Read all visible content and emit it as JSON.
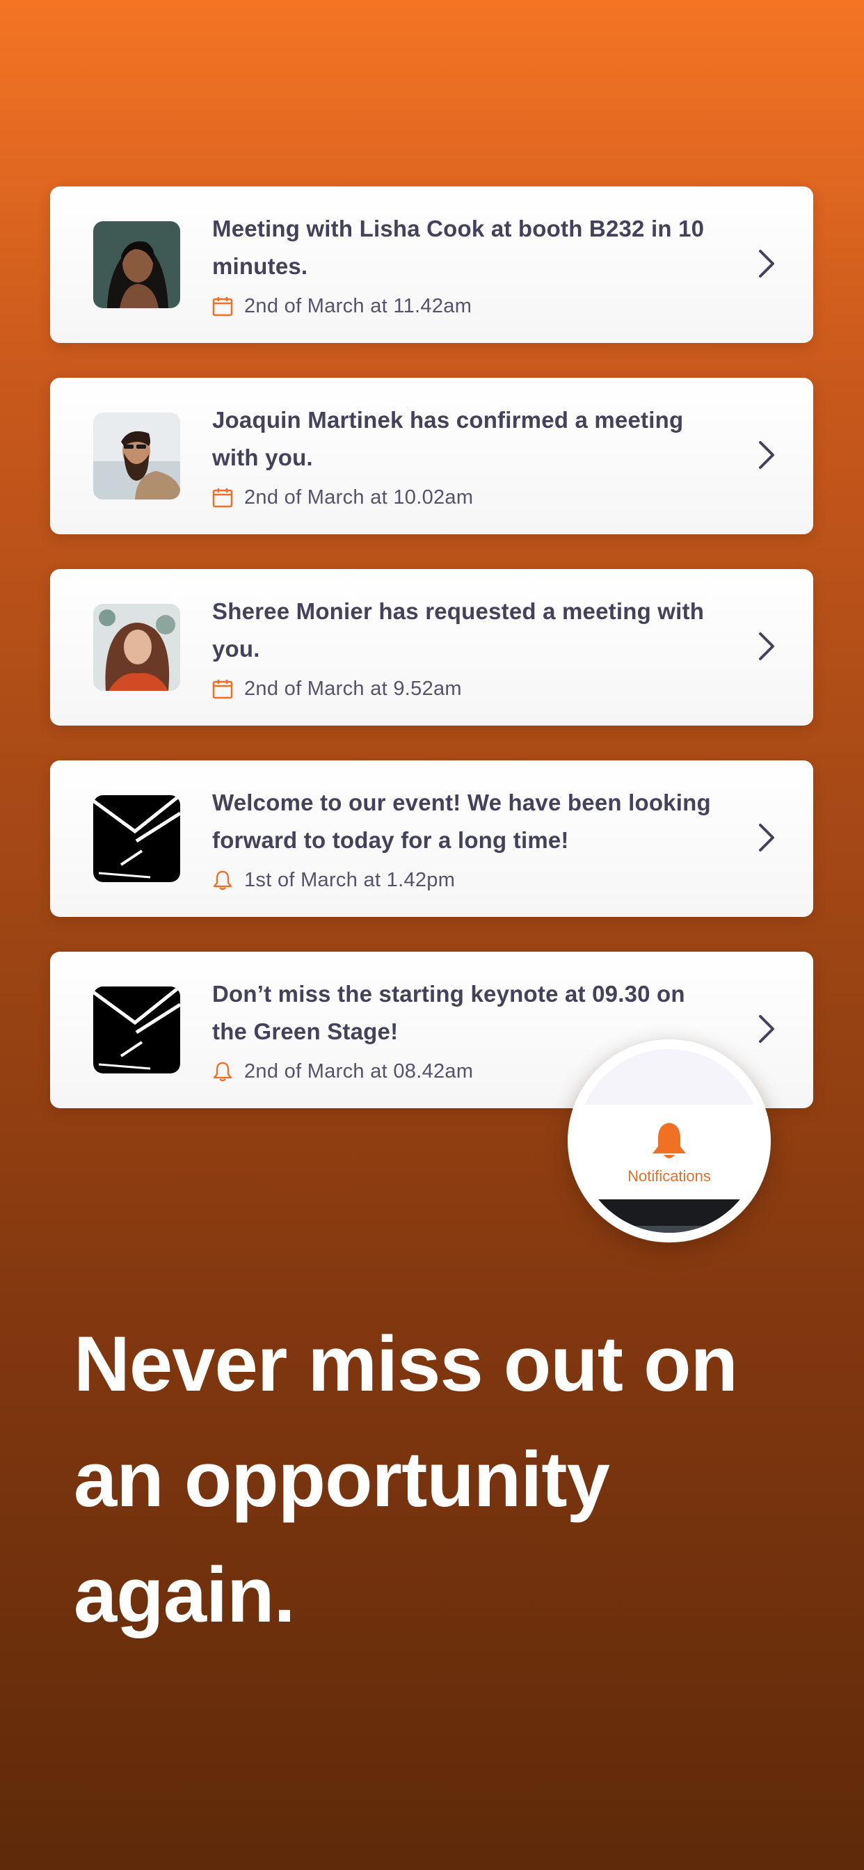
{
  "notifications": [
    {
      "title": "Meeting with Lisha Cook at booth B232 in 10 minutes.",
      "time": "2nd of March at 11.42am",
      "icon": "calendar-icon",
      "avatar": "Lisha Cook"
    },
    {
      "title": "Joaquin Martinek has confirmed a meeting with you.",
      "time": "2nd of March at 10.02am",
      "icon": "calendar-icon",
      "avatar": "Joaquin Martinek"
    },
    {
      "title": "Sheree Monier has requested a meeting with you.",
      "time": "2nd of March at 9.52am",
      "icon": "calendar-icon",
      "avatar": "Sheree Monier"
    },
    {
      "title": "Welcome to our event! We have been looking forward to today for a long time!",
      "time": "1st of March at 1.42pm",
      "icon": "bell-icon",
      "avatar": "event-logo"
    },
    {
      "title": "Don’t miss the starting keynote at 09.30 on the Green Stage!",
      "time": "2nd of March at 08.42am",
      "icon": "bell-icon",
      "avatar": "event-logo"
    }
  ],
  "tab_bubble": {
    "label": "Notifications",
    "icon": "bell-icon"
  },
  "headline": "Never miss out on an opportunity again.",
  "colors": {
    "accent": "#F47424",
    "text": "#44425A",
    "background_top": "#F47424",
    "background_bottom": "#5E2A0A"
  }
}
